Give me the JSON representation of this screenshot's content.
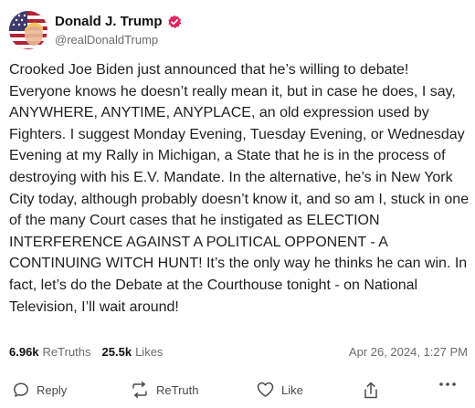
{
  "author": {
    "display_name": "Donald J. Trump",
    "handle": "@realDonaldTrump",
    "verified_color": "#e0245e",
    "avatar_icon": "avatar-flag"
  },
  "post": {
    "text": "Crooked Joe Biden just announced that he’s willing to debate! Everyone knows he doesn’t really mean it, but in case he does, I say, ANYWHERE, ANYTIME, ANYPLACE, an old expression used by Fighters. I suggest Monday Evening, Tuesday Evening, or Wednesday Evening at my Rally in Michigan, a State that he is in the process of destroying with his E.V. Mandate. In the alternative, he’s in New York City today, although probably doesn’t know it, and so am I, stuck in one of the many Court cases that he instigated as ELECTION INTERFERENCE AGAINST A POLITICAL OPPONENT - A CONTINUING WITCH HUNT! It’s the only way he thinks he can win. In fact, let’s do the Debate at the Courthouse tonight - on National Television, I’ll wait around!"
  },
  "stats": {
    "retruths_count": "6.96k",
    "retruths_label": "ReTruths",
    "likes_count": "25.5k",
    "likes_label": "Likes",
    "timestamp": "Apr 26, 2024, 1:27 PM"
  },
  "actions": {
    "reply_label": "Reply",
    "retruth_label": "ReTruth",
    "like_label": "Like",
    "icons": [
      "reply-icon",
      "retruth-icon",
      "like-icon",
      "share-icon",
      "more-icon"
    ]
  }
}
